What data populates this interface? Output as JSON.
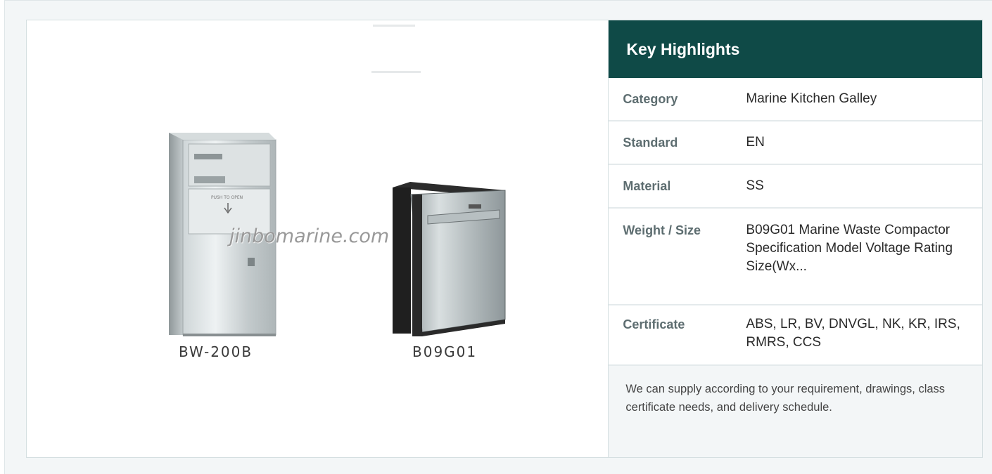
{
  "image": {
    "watermark": "jinbomarine.com",
    "products": [
      {
        "label": "BW-200B"
      },
      {
        "label": "B09G01"
      }
    ]
  },
  "highlights": {
    "title": "Key Highlights",
    "rows": [
      {
        "key": "Category",
        "value": "Marine Kitchen Galley"
      },
      {
        "key": "Standard",
        "value": "EN"
      },
      {
        "key": "Material",
        "value": "SS"
      },
      {
        "key": "Weight / Size",
        "value": "B09G01 Marine Waste Compactor Specification Model Voltage Rating Size(Wx..."
      },
      {
        "key": "Certificate",
        "value": "ABS, LR, BV, DNVGL, NK, KR, IRS, RMRS, CCS"
      }
    ],
    "note": "We can supply according to your requirement, drawings, class certificate needs, and delivery schedule."
  },
  "colors": {
    "header_bg": "#0f4a47",
    "key_text": "#5d6d70",
    "note_bg": "#f3f6f7"
  }
}
